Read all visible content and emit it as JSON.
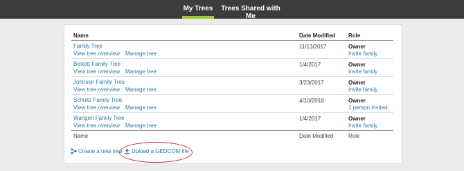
{
  "tabs": [
    {
      "label": "My Trees",
      "active": true
    },
    {
      "label": "Trees Shared with Me",
      "active": false
    }
  ],
  "columns": {
    "name": "Name",
    "date": "Date Modified",
    "role": "Role"
  },
  "rows": [
    {
      "name": "Family Tree",
      "view": "View tree overview",
      "manage": "Manage tree",
      "date": "11/13/2017",
      "role": "Owner",
      "role_action": "Invite family"
    },
    {
      "name": "Bickett Family Tree",
      "view": "View tree overview",
      "manage": "Manage tree",
      "date": "1/4/2017",
      "role": "Owner",
      "role_action": "Invite family"
    },
    {
      "name": "Johnson Family Tree",
      "view": "View tree overview",
      "manage": "Manage tree",
      "date": "3/23/2017",
      "role": "Owner",
      "role_action": "Invite family"
    },
    {
      "name": "Schultz Family Tree",
      "view": "View tree overview",
      "manage": "Manage tree",
      "date": "4/10/2018",
      "role": "Owner",
      "role_action": "1 person invited"
    },
    {
      "name": "Wangen Family Tree",
      "view": "View tree overview",
      "manage": "Manage tree",
      "date": "1/4/2017",
      "role": "Owner",
      "role_action": "Invite family"
    }
  ],
  "footer": {
    "name": "Name",
    "date": "Date Modified",
    "role": "Role"
  },
  "actions": {
    "create": "Create a new tree",
    "upload": "Upload a GEDCOM file"
  },
  "colors": {
    "accent": "#9fcb39",
    "link": "#2a7aa3",
    "highlight": "#c8373b"
  },
  "icons": {
    "create": "tree-icon",
    "upload": "upload-icon"
  }
}
